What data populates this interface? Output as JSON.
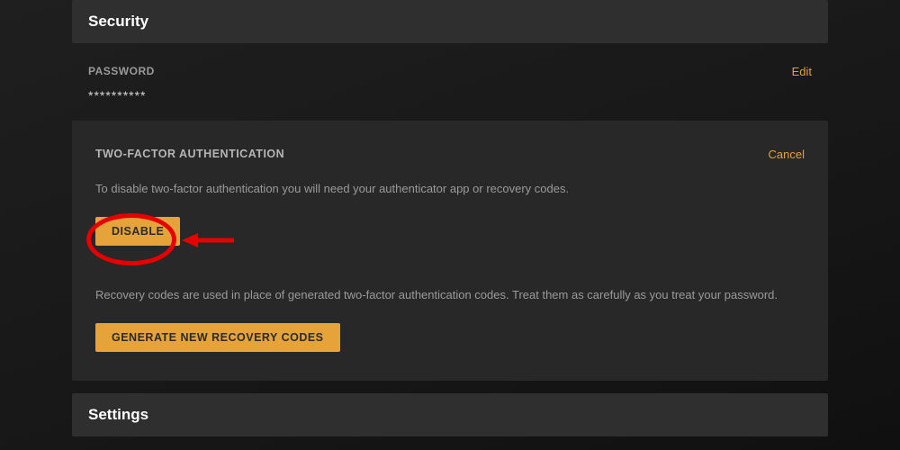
{
  "security": {
    "title": "Security",
    "password": {
      "label": "PASSWORD",
      "value": "**********",
      "edit": "Edit"
    },
    "tfa": {
      "title": "TWO-FACTOR AUTHENTICATION",
      "cancel": "Cancel",
      "desc": "To disable two-factor authentication you will need your authenticator app or recovery codes.",
      "disable_btn": "DISABLE",
      "recovery_desc": "Recovery codes are used in place of generated two-factor authentication codes. Treat them as carefully as you treat your password.",
      "generate_btn": "GENERATE NEW RECOVERY CODES"
    }
  },
  "settings": {
    "title": "Settings"
  }
}
